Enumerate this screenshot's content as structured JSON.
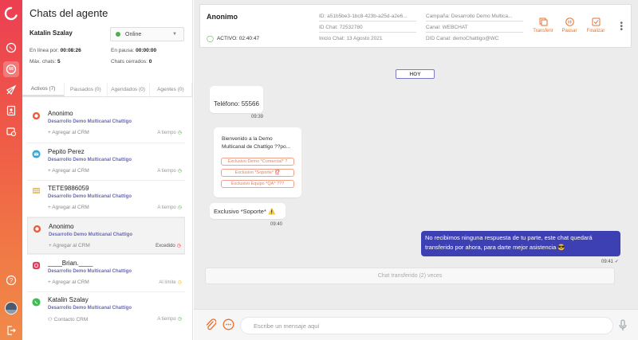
{
  "agent_panel": {
    "title": "Chats del agente",
    "agent_name": "Katalin Szalay",
    "status": {
      "value": "Online",
      "color": "#4caf50"
    },
    "stats": {
      "online_label": "En línea por:",
      "online_value": "00:08:26",
      "paused_label": "En pausa:",
      "paused_value": "00:00:00",
      "max_label": "Máx. chats:",
      "max_value": "5",
      "closed_label": "Chats cerrados:",
      "closed_value": "0"
    },
    "tabs": [
      "Activos (7)",
      "Pausados (0)",
      "Agendados (0)",
      "Agentes (0)"
    ]
  },
  "chats": [
    {
      "name": "Anonimo",
      "campaign": "Desarrollo Demo Multicanal Chattigo",
      "crm": "Agregar al CRM",
      "status": "A tiempo",
      "channel_icon": "webchat-icon",
      "status_color": "#4caf50"
    },
    {
      "name": "Pepito Perez",
      "campaign": "Desarrollo Demo Multicanal Chattigo",
      "crm": "Agregar al CRM",
      "status": "A tiempo",
      "channel_icon": "email-icon",
      "status_color": "#4caf50"
    },
    {
      "name": "TETE9886059",
      "campaign": "Desarrollo Demo Multicanal Chattigo",
      "crm": "Agregar al CRM",
      "status": "A tiempo",
      "channel_icon": "sms-icon",
      "status_color": "#4caf50"
    },
    {
      "name": "Anonimo",
      "campaign": "Desarrollo Demo Multicanal Chattigo",
      "crm": "Agregar al CRM",
      "status": "Excedido",
      "channel_icon": "webchat-icon",
      "status_color": "#e53935"
    },
    {
      "name": "____Brian.____",
      "campaign": "Desarrollo Demo Multicanal Chattigo",
      "crm": "Agregar al CRM",
      "status": "Al límite",
      "channel_icon": "instagram-icon",
      "status_color": "#f0b400"
    },
    {
      "name": "Katalin Szalay",
      "campaign": "Desarrollo Demo Multicanal Chattigo",
      "crm": "Contacto CRM",
      "status": "A tiempo",
      "channel_icon": "whatsapp-icon",
      "status_color": "#4caf50"
    }
  ],
  "header": {
    "name": "Anonimo",
    "active_label": "ACTIVO: 02:40:47",
    "id": "ID: a51b5be3-1bc8-423b-a25d-a2e6...",
    "id_chat": "ID Chat: 72532780",
    "start": "Inicio Chat: 13 Agosto 2021",
    "campaign": "Campaña: Desarrollo Demo Multica...",
    "channel": "Canal: WEBCHAT",
    "did": "DID Canal: demoChattigo@WC",
    "actions": [
      "Transferir",
      "Pausar",
      "Finalizar"
    ]
  },
  "conversation": {
    "day": "HOY",
    "msg1": {
      "text": "Teléfono: 55566",
      "time": "09:39"
    },
    "msg2": {
      "text": "Bienvenido a la Demo Multicanal de Chattigo ??po...",
      "options": [
        "Exclusivo Demo *Comercial* ?",
        "Exclusivo *Soporte* ⁉️",
        "Exclusivo Equipo *QA* ???"
      ]
    },
    "msg3": {
      "text": "Exclusivo *Soporte* ⚠️",
      "time": "09:40"
    },
    "msg4": {
      "text": "No recibimos ninguna respuesta de tu parte, este chat quedará transferido por ahora, para darte mejor asistencia 😎",
      "time": "09:41"
    },
    "transfer_note": "Chat transferido (2) veces"
  },
  "composer": {
    "placeholder": "Escribe un mensaje aquí"
  },
  "colors": {
    "accent": "#e8702a",
    "brand_gradient_top": "#ec3f52",
    "outgoing": "#3d40b3"
  }
}
